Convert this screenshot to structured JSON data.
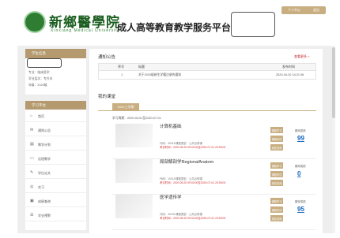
{
  "header": {
    "logo_cn": "新鄉醫學院",
    "logo_en": "Xinxiang Medical University",
    "title": "成人高等教育教学服务平台",
    "top_actions": [
      "个人中心",
      "退出"
    ]
  },
  "sidebar": {
    "head": "学生信息",
    "info": [
      "专业：临床医学",
      "学业层次：专升本",
      "年级：2020级"
    ],
    "nav_head": "学习平台",
    "items": [
      {
        "icon": "⌂",
        "label": "首页"
      },
      {
        "icon": "✉",
        "label": "通知公告"
      },
      {
        "icon": "▤",
        "label": "教学计划"
      },
      {
        "icon": "▭",
        "label": "远程教学"
      },
      {
        "icon": "✎",
        "label": "学位论文"
      },
      {
        "icon": "◎",
        "label": "实习"
      },
      {
        "icon": "▣",
        "label": "成绩查询"
      },
      {
        "icon": "☰",
        "label": "学业预警"
      }
    ]
  },
  "notices": {
    "title": "通知公告",
    "more": "查看更多 >",
    "cols": [
      "序号",
      "标题",
      "发布时间"
    ],
    "rows": [
      {
        "no": "1",
        "title": "关于2020级新生学籍注册的通知",
        "time": "2020-04-20 14:21:36"
      }
    ]
  },
  "courses": {
    "title": "我的课堂",
    "tab": "2020上学期",
    "period": "学习周期：2020-03-01至2020-07-01",
    "items": [
      {
        "name": "计算机基础",
        "code": "代码：30016",
        "credit": "学分：3",
        "hours": "课程类型：公共必修课",
        "exam": "考试时间：2020-05-20 09:00:00至2020-07-01 23:59:00",
        "buttons": [
          "课程学习",
          "课程考试",
          "成绩查询"
        ],
        "score_label": "期末成绩",
        "score": "99"
      },
      {
        "name": "局部解剖学RegionalAnatom",
        "code": "代码：10015",
        "credit": "学分：4",
        "hours": "课程类型：公共必修课",
        "exam": "考试时间：2020-05-20 09:00:00至2020-07-01 23:59:00",
        "buttons": [
          "课程学习",
          "课程考试",
          "成绩查询"
        ],
        "score_label": "期末成绩",
        "score": "0"
      },
      {
        "name": "医学遗传学",
        "code": "代码：40151",
        "credit": "学分：3",
        "hours": "课程类型：公共必修课",
        "exam": "考试时间：2020-05-20 09:00:00至2020-07-01 23:59:00",
        "buttons": [
          "课程学习",
          "课程考试",
          "成绩查询"
        ],
        "score_label": "期末成绩",
        "score": "95"
      }
    ]
  }
}
